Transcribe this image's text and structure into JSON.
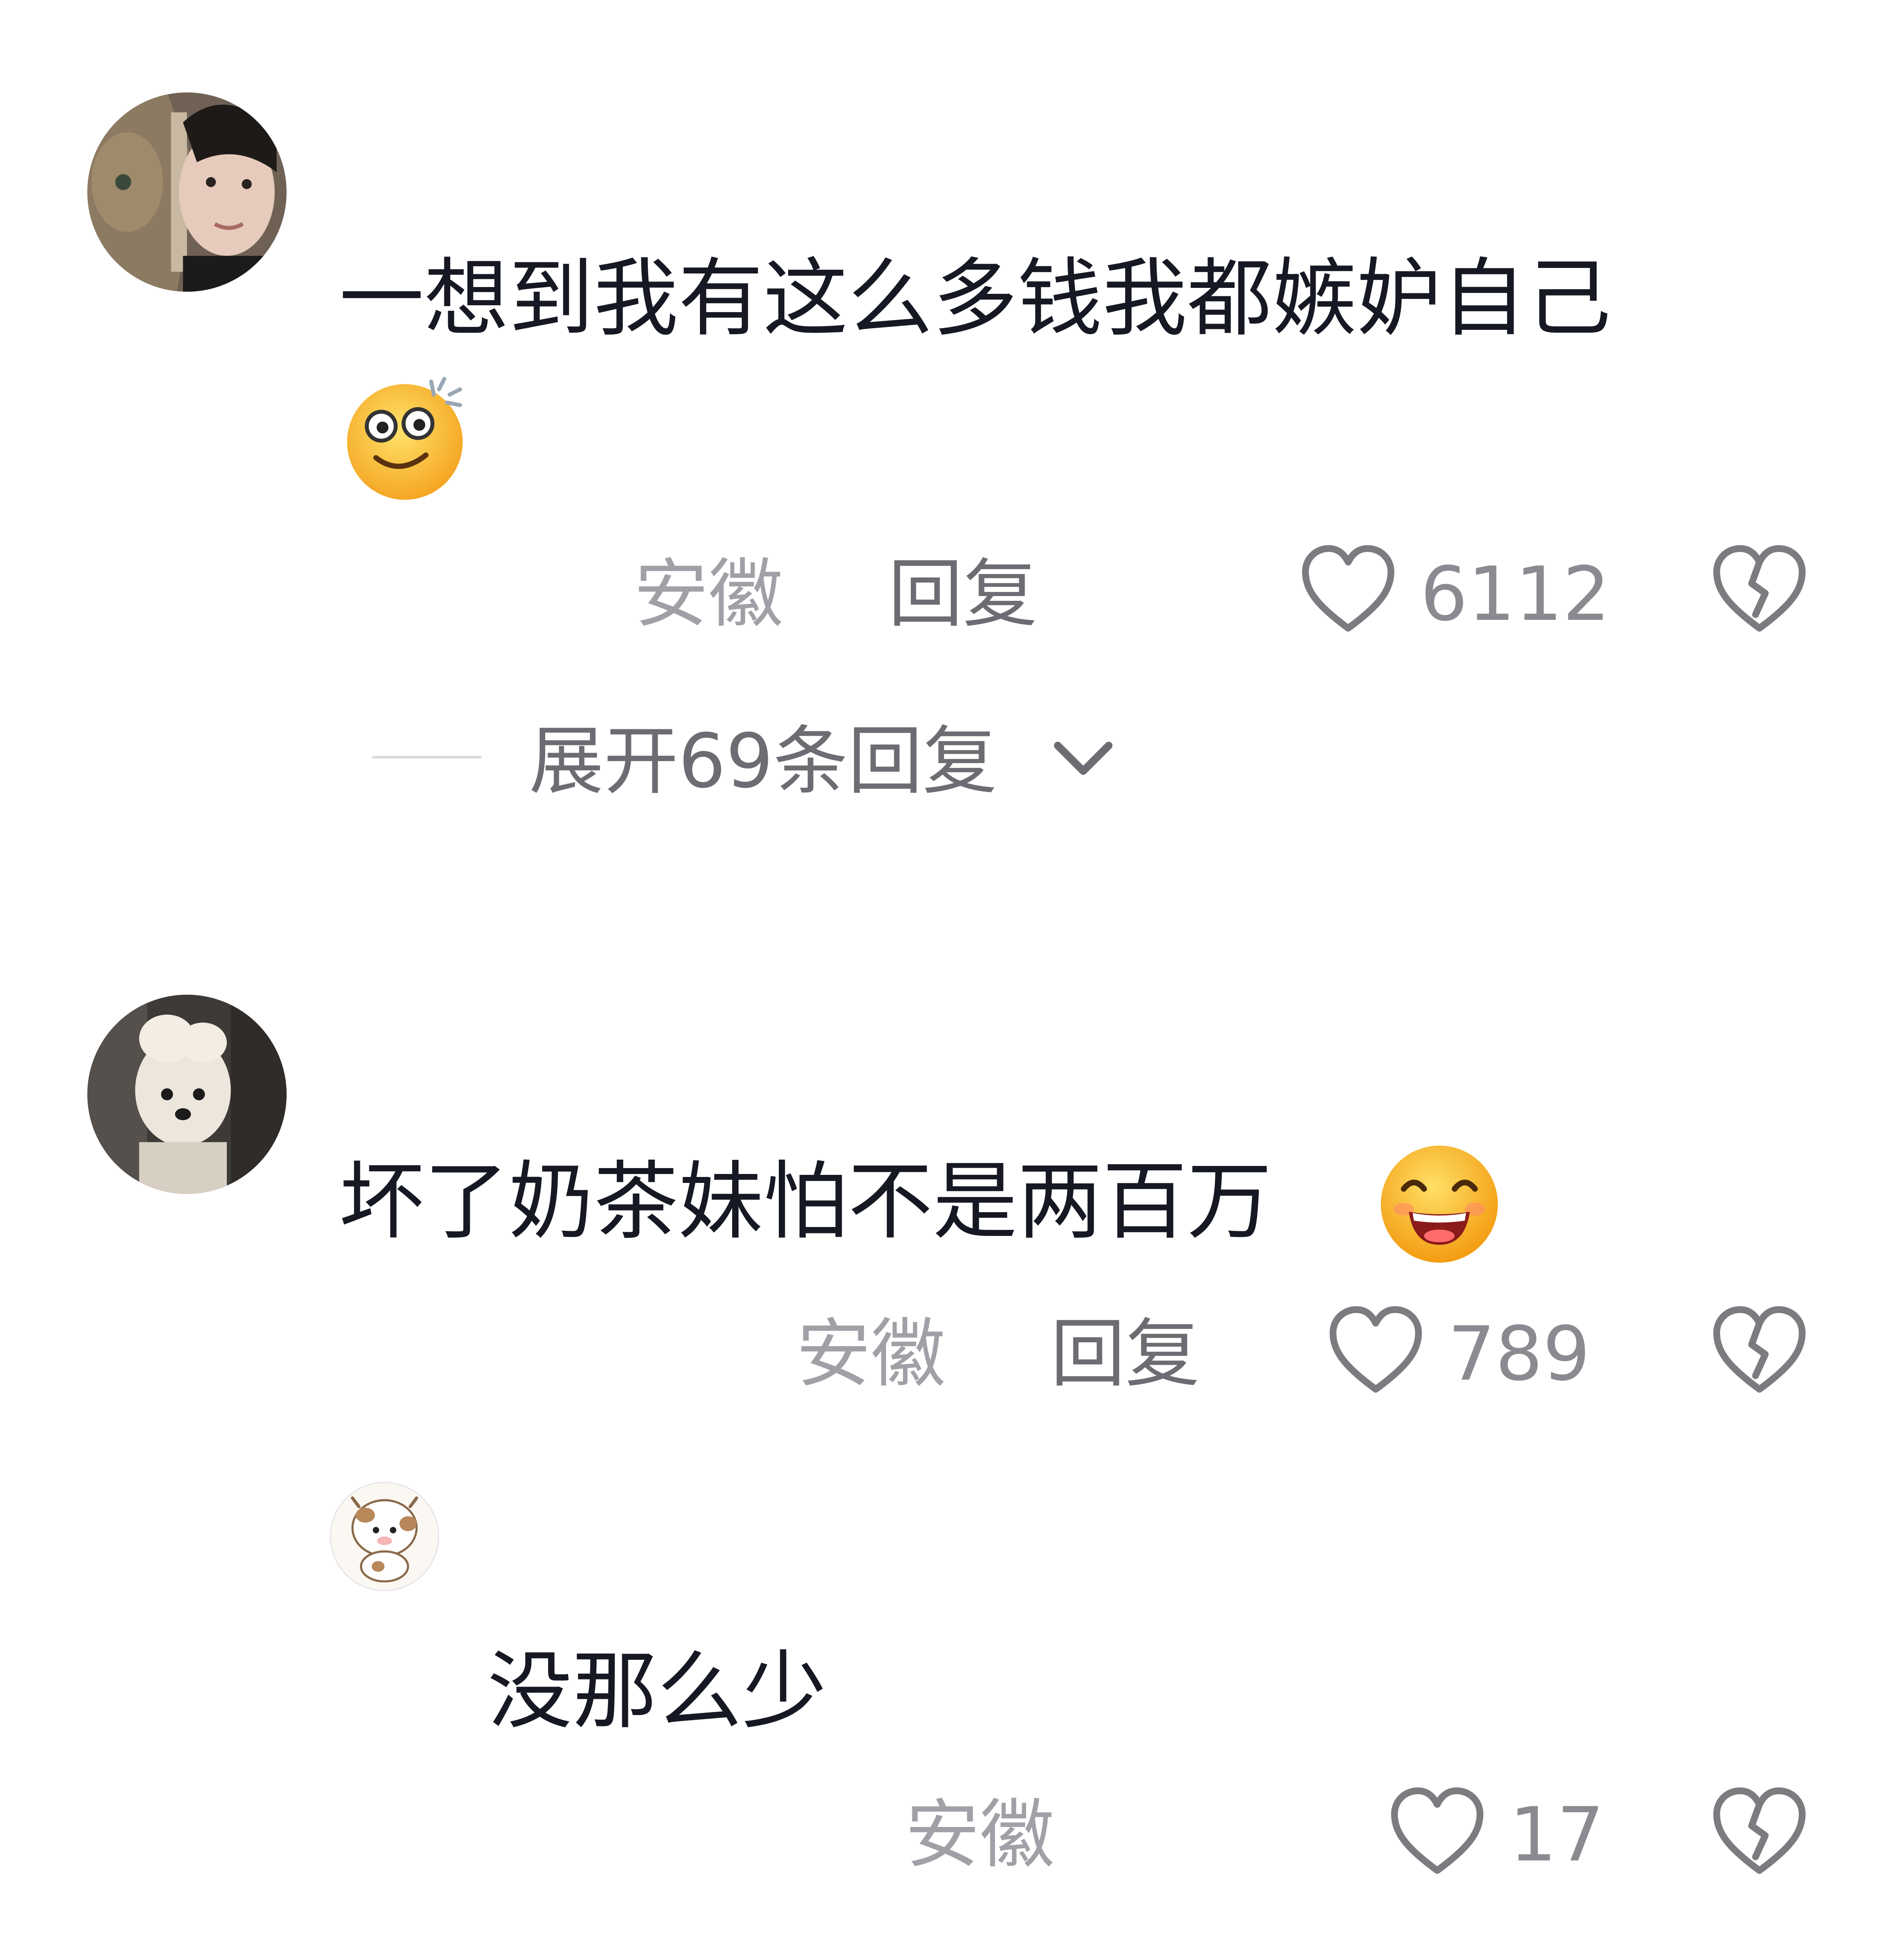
{
  "comments": [
    {
      "text": "一想到我有这么多钱我都嫉妒自己",
      "emoji": "dizzy-smile-emoji",
      "location": "安徽",
      "reply_label": "回复",
      "like_count": "6112",
      "expand_label": "展开69条回复"
    },
    {
      "text": "坏了奶茶妹怕不是两百万",
      "emoji": "grin-emoji",
      "location": "安徽",
      "reply_label": "回复",
      "like_count": "789"
    },
    {
      "text": "没那么少",
      "location": "安徽",
      "like_count": "17"
    }
  ],
  "icons": {
    "like": "heart-icon",
    "dislike": "broken-heart-icon",
    "expand": "chevron-down-icon"
  },
  "colors": {
    "text": "#161823",
    "meta": "#a0a1a6",
    "reply": "#6c6d72",
    "background": "#ffffff"
  }
}
